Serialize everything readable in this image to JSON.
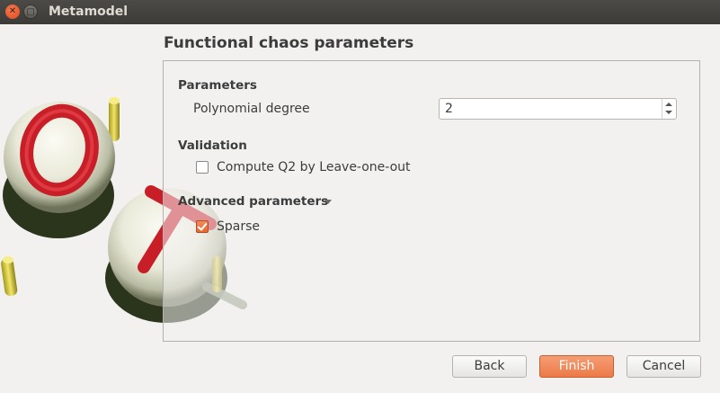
{
  "window": {
    "title": "Metamodel"
  },
  "page": {
    "title": "Functional chaos parameters"
  },
  "parameters": {
    "section_label": "Parameters",
    "polynomial_degree_label": "Polynomial degree",
    "polynomial_degree_value": "2"
  },
  "validation": {
    "section_label": "Validation",
    "leave_one_out_label": "Compute Q2 by Leave-one-out",
    "leave_one_out_checked": false
  },
  "advanced": {
    "section_label": "Advanced parameters",
    "expanded": true,
    "sparse_label": "Sparse",
    "sparse_checked": true
  },
  "buttons": {
    "back": "Back",
    "finish": "Finish",
    "cancel": "Cancel"
  },
  "colors": {
    "accent": "#ed7a47",
    "titlebar": "#3c3b37",
    "logo_red": "#c81e28"
  }
}
